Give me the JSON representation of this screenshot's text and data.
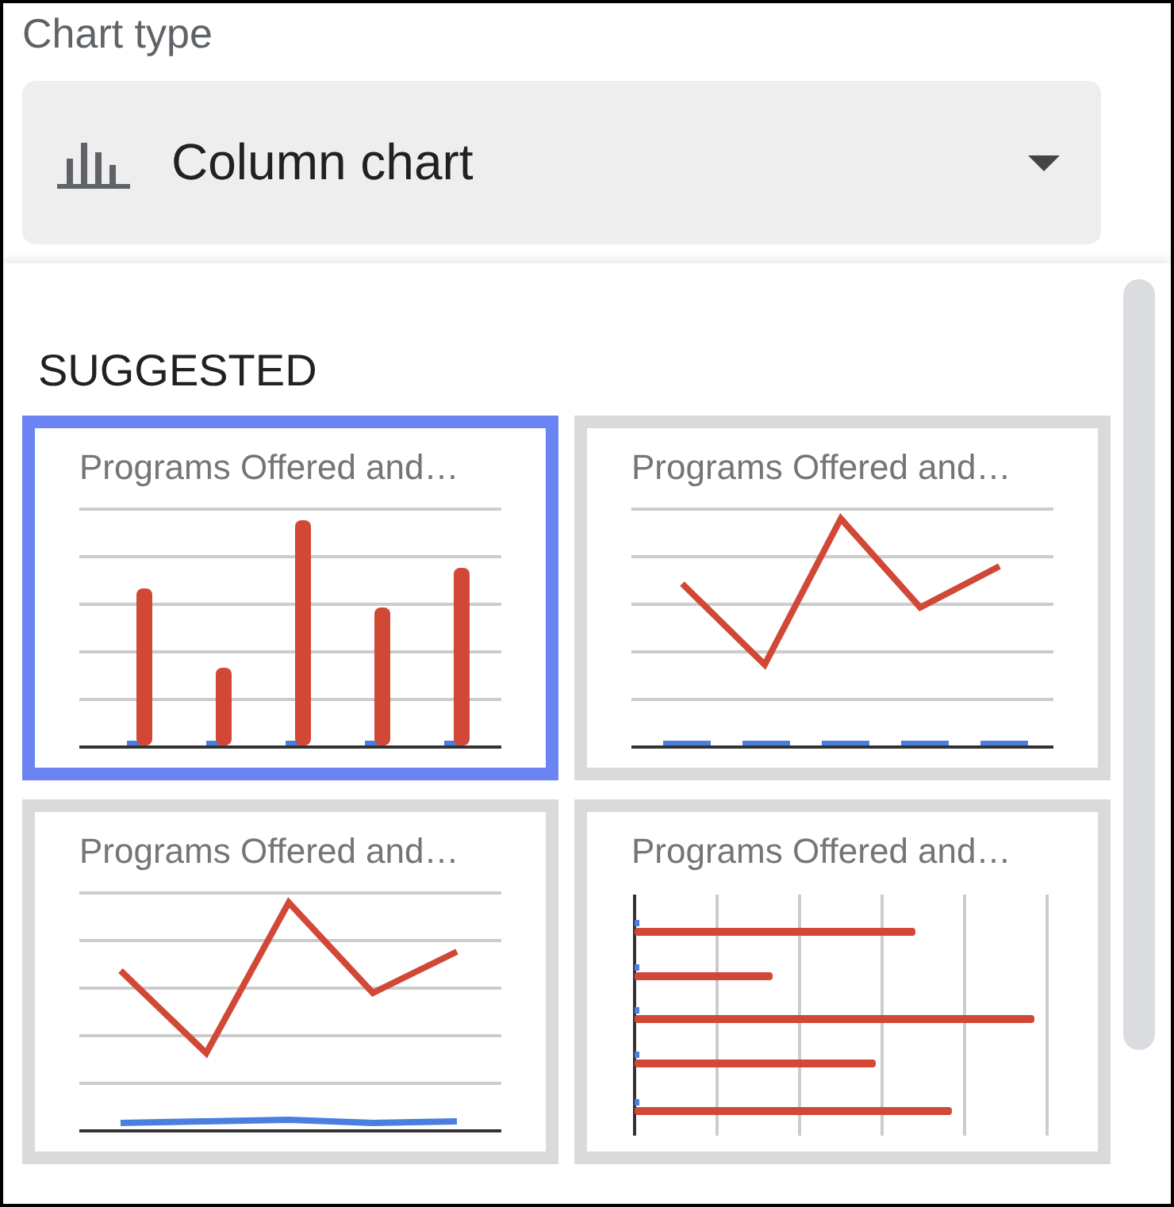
{
  "label": "Chart type",
  "select": {
    "value": "Column chart"
  },
  "section": "SUGGESTED",
  "thumbnails": [
    {
      "title": "Programs Offered and…",
      "kind": "column",
      "selected": true
    },
    {
      "title": "Programs Offered and…",
      "kind": "combo",
      "selected": false
    },
    {
      "title": "Programs Offered and…",
      "kind": "line",
      "selected": false
    },
    {
      "title": "Programs Offered and…",
      "kind": "bar",
      "selected": false
    }
  ]
}
